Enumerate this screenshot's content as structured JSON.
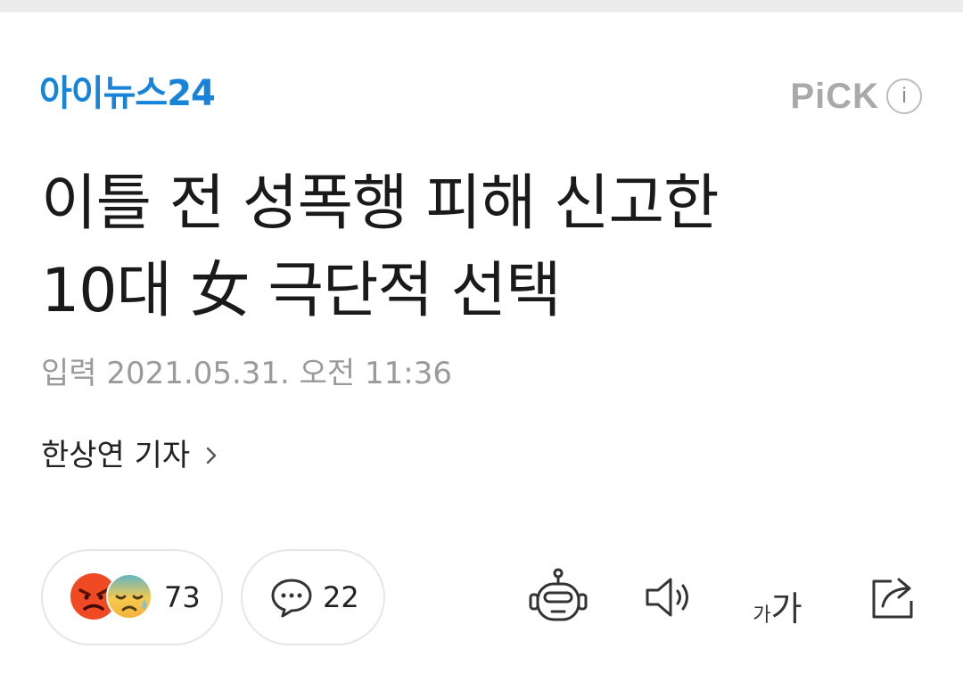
{
  "press": {
    "logo_text": "아이뉴스24"
  },
  "pick": {
    "label": "PiCK",
    "info_glyph": "i"
  },
  "article": {
    "headline_line1": "이틀 전 성폭행 피해 신고한",
    "headline_line2": "10대 女 극단적 선택",
    "dateline": "입력 2021.05.31. 오전 11:36",
    "reporter": "한상연 기자"
  },
  "reactions": {
    "count": "73",
    "icons": [
      "angry-emoji-icon",
      "sad-sweat-emoji-icon"
    ]
  },
  "comments": {
    "count": "22",
    "icon": "speech-bubble-icon"
  },
  "tools": {
    "summary_bot_icon": "robot-icon",
    "tts_icon": "speaker-icon",
    "font_small": "가",
    "font_big": "가",
    "share_icon": "share-icon"
  },
  "colors": {
    "logo": "#1784d9",
    "pick": "#a9a9a9",
    "dateline": "#9a9a9a",
    "headline": "#1a1a1a"
  }
}
